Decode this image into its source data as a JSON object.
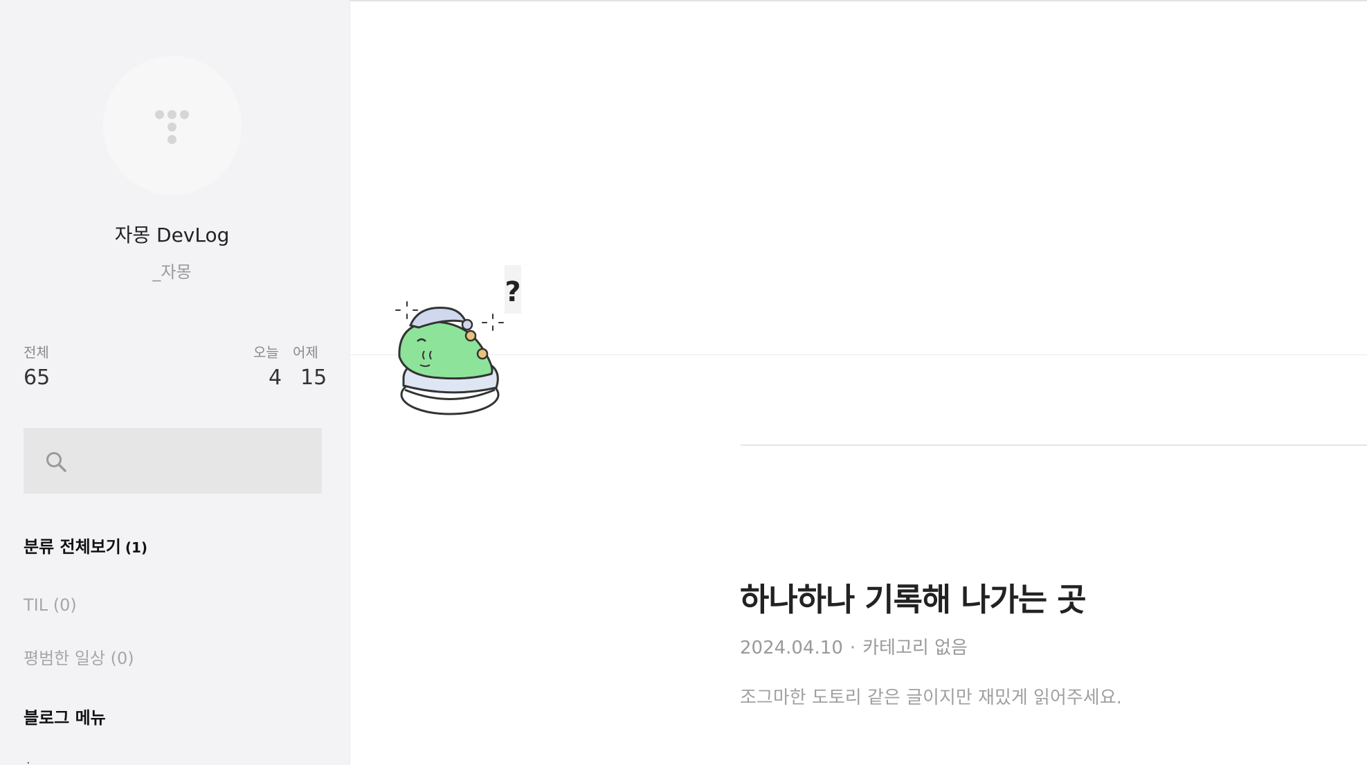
{
  "sidebar": {
    "blog_title": "자몽 DevLog",
    "owner": "_자몽",
    "stats": {
      "total_label": "전체",
      "total_value": "65",
      "today_label": "오늘",
      "today_value": "4",
      "yesterday_label": "어제",
      "yesterday_value": "15"
    },
    "search": {
      "placeholder": ""
    },
    "categories": {
      "all_label": "분류 전체보기",
      "all_count": "(1)",
      "items": [
        {
          "label": "TIL (0)"
        },
        {
          "label": "평범한 일상 (0)"
        }
      ]
    },
    "menu_heading": "블로그 메뉴"
  },
  "main": {
    "sticker": {
      "mark": "?"
    },
    "post": {
      "title": "하나하나 기록해 나가는 곳",
      "date": "2024.04.10",
      "separator": "·",
      "category": "카테고리 없음",
      "excerpt": "조그마한 도토리 같은 글이지만 재밌게 읽어주세요."
    }
  }
}
